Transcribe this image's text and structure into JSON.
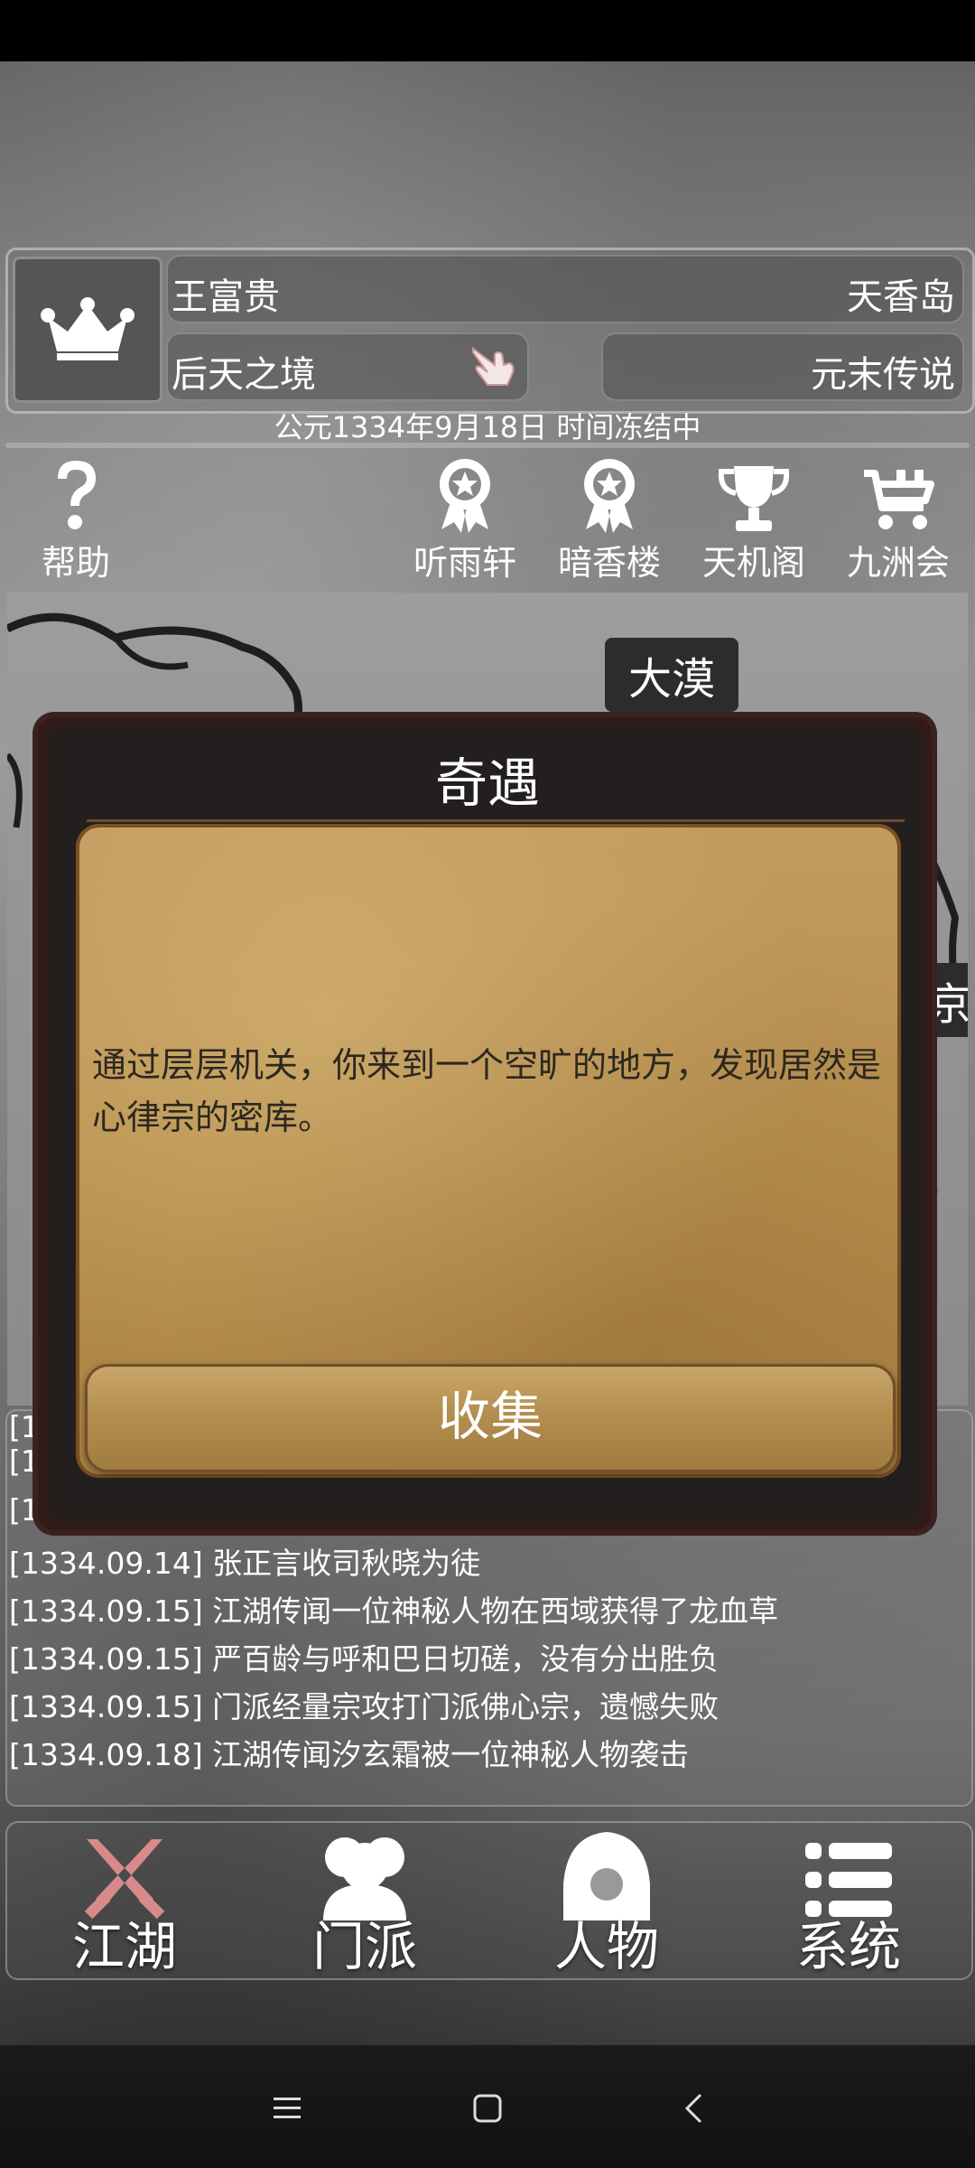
{
  "player": {
    "name": "王富贵",
    "location": "天香岛",
    "realm": "后天之境",
    "scenario": "元末传说"
  },
  "date_status": "公元1334年9月18日 时间冻结中",
  "top_menu": [
    {
      "label": "帮助",
      "icon": "help-icon"
    },
    {
      "label": "听雨轩",
      "icon": "award-ribbon-icon"
    },
    {
      "label": "暗香楼",
      "icon": "award-ribbon-icon"
    },
    {
      "label": "天机阁",
      "icon": "trophy-icon"
    },
    {
      "label": "九洲会",
      "icon": "cart-icon"
    }
  ],
  "map": {
    "regions": [
      "大漠",
      "京"
    ]
  },
  "log": [
    "[1334.09.14] 张正言收司秋晓为徒",
    "[1334.09.15] 江湖传闻一位神秘人物在西域获得了龙血草",
    "[1334.09.15] 严百龄与呼和巴日切磋，没有分出胜负",
    "[1334.09.15] 门派经量宗攻打门派佛心宗，遗憾失败",
    "[1334.09.18] 江湖传闻汐玄霜被一位神秘人物袭击"
  ],
  "log_partial": [
    "[13",
    "[13",
    "[13"
  ],
  "dialog": {
    "title": "奇遇",
    "text": "通过层层机关，你来到一个空旷的地方，发现居然是心律宗的密库。",
    "button": "收集"
  },
  "bottom_nav": [
    {
      "label": "江湖",
      "icon": "crossed-swords-icon",
      "color": "#d88a8a"
    },
    {
      "label": "门派",
      "icon": "group-icon",
      "color": "#ffffff"
    },
    {
      "label": "人物",
      "icon": "person-icon",
      "color": "#ffffff"
    },
    {
      "label": "系统",
      "icon": "list-icon",
      "color": "#ffffff"
    }
  ]
}
